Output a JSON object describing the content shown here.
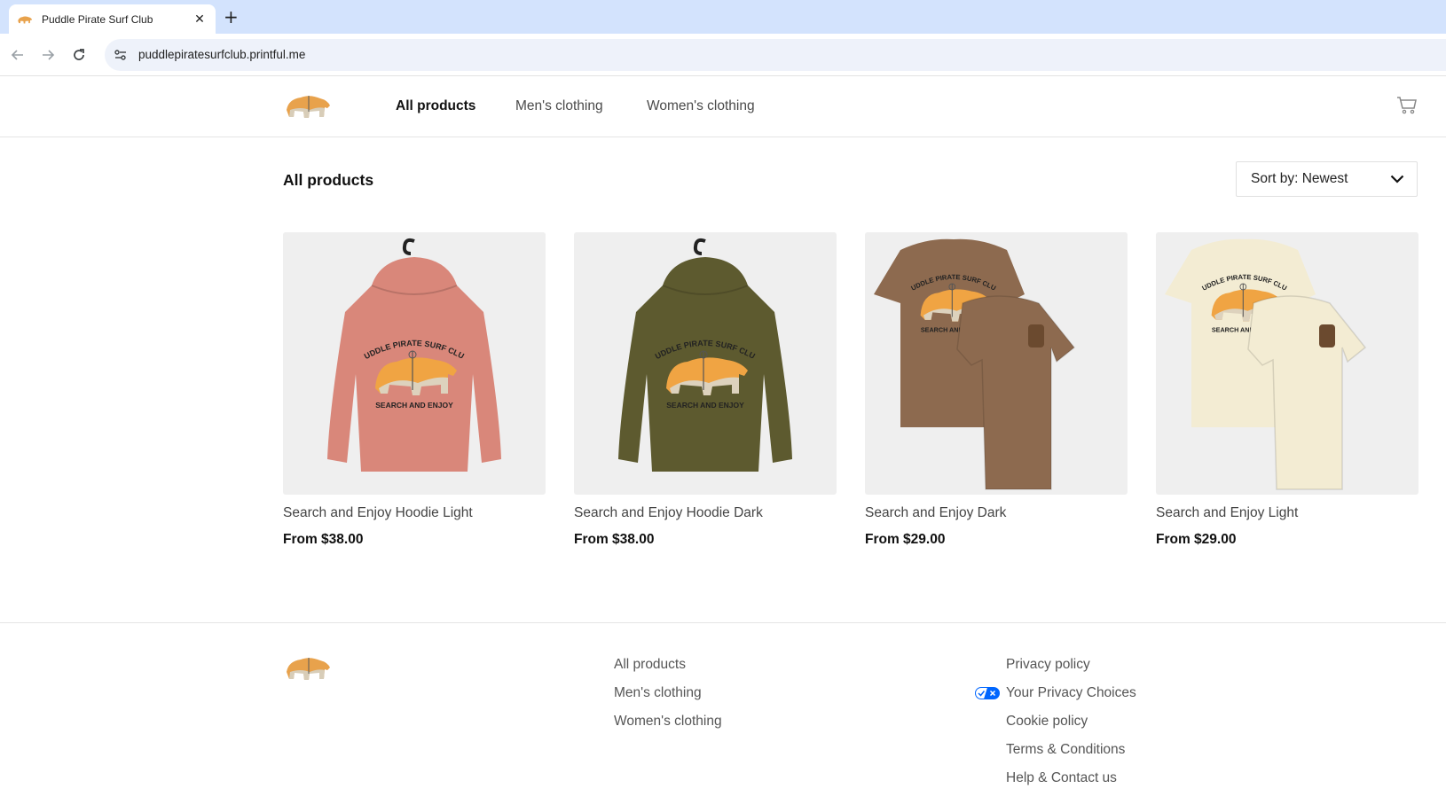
{
  "browser": {
    "tab_title": "Puddle Pirate Surf Club",
    "url": "puddlepiratesurfclub.printful.me"
  },
  "nav": {
    "links": [
      "All products",
      "Men's clothing",
      "Women's clothing"
    ],
    "active": "All products"
  },
  "main": {
    "heading": "All products",
    "sort_label": "Sort by: Newest"
  },
  "products": [
    {
      "name": "Search and Enjoy Hoodie Light",
      "price": "From $38.00",
      "color": "#d9877a",
      "kind": "hoodie"
    },
    {
      "name": "Search and Enjoy Hoodie Dark",
      "price": "From $38.00",
      "color": "#5d5a2f",
      "kind": "hoodie"
    },
    {
      "name": "Search and Enjoy Dark",
      "price": "From $29.00",
      "color": "#8d6a4f",
      "kind": "tshirt"
    },
    {
      "name": "Search and Enjoy Light",
      "price": "From $29.00",
      "color": "#f3ecd3",
      "kind": "tshirt"
    }
  ],
  "print": {
    "arc_text": "PUDDLE PIRATE SURF CLUB",
    "bottom_text": "SEARCH AND ENJOY"
  },
  "footer": {
    "nav_links": [
      "All products",
      "Men's clothing",
      "Women's clothing"
    ],
    "legal_links": [
      "Privacy policy",
      "Your Privacy Choices",
      "Cookie policy",
      "Terms & Conditions",
      "Help & Contact us"
    ]
  }
}
